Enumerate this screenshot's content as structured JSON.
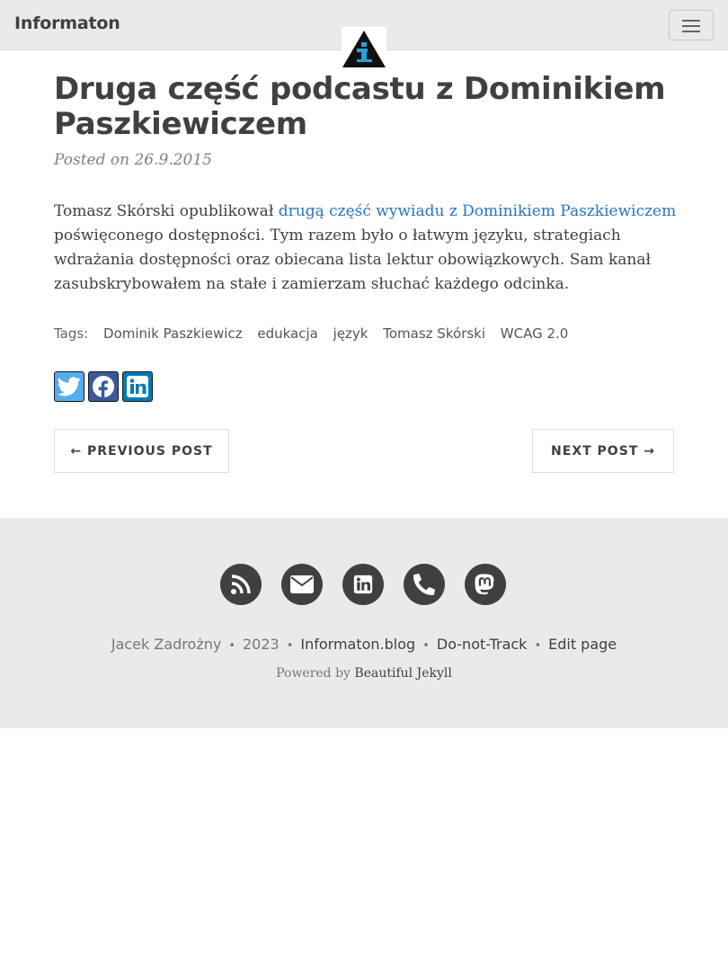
{
  "navbar": {
    "brand": "Informaton",
    "menu_toggle_icon": "hamburger-icon",
    "avatar_icon": "information-logo-icon"
  },
  "post": {
    "title": "Druga część podcastu z Dominikiem Paszkiewiczem",
    "meta": "Posted on 26.9.2015",
    "body_before_link": "Tomasz Skórski opublikował ",
    "body_link": "drugą część wywiadu z Dominikiem Paszkiewiczem",
    "body_after_link": " poświęconego dostępności. Tym razem było o łatwym języku, strategiach wdrażania dostępności oraz obiecana lista lektur obowiązkowych. Sam kanał zasubskrybowałem na stałe i zamierzam słuchać każdego odcinka.",
    "tags_label": "Tags:",
    "tags": [
      "Dominik Paszkiewicz",
      "edukacja",
      "język",
      "Tomasz Skórski",
      "WCAG 2.0"
    ]
  },
  "share": [
    {
      "icon": "twitter-icon",
      "color": "#55acee"
    },
    {
      "icon": "facebook-icon",
      "color": "#3b5998"
    },
    {
      "icon": "linkedin-icon",
      "color": "#007bb5"
    }
  ],
  "pager": {
    "previous": "← PREVIOUS POST",
    "next": "NEXT POST →"
  },
  "footer": {
    "social_icons": [
      "rss-icon",
      "envelope-icon",
      "linkedin-icon",
      "phone-icon",
      "mastodon-icon"
    ],
    "author": "Jacek Zadrożny",
    "year": "2023",
    "site": "Informaton.blog",
    "dnt": "Do-not-Track",
    "edit": "Edit page",
    "powered_prefix": "Powered by ",
    "powered_link": "Beautiful Jekyll"
  }
}
